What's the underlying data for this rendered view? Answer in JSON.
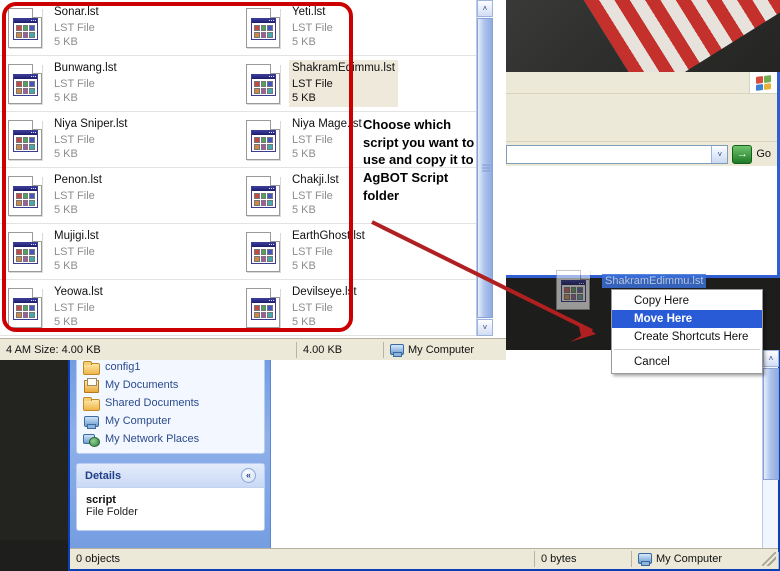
{
  "annotation": {
    "text": "Choose which script you want to use and copy it to AgBOT Script folder",
    "arrow_color": "#b02020",
    "highlight_box_color": "#cc0000"
  },
  "file_window": {
    "files": [
      {
        "name": "Sonar.lst",
        "type": "LST File",
        "size": "5 KB",
        "selected": false
      },
      {
        "name": "Yeti.lst",
        "type": "LST File",
        "size": "5 KB",
        "selected": false
      },
      {
        "name": "Bunwang.lst",
        "type": "LST File",
        "size": "5 KB",
        "selected": false
      },
      {
        "name": "ShakramEdimmu.lst",
        "type": "LST File",
        "size": "5 KB",
        "selected": true
      },
      {
        "name": "Niya Sniper.lst",
        "type": "LST File",
        "size": "5 KB",
        "selected": false
      },
      {
        "name": "Niya Mage.lst",
        "type": "LST File",
        "size": "5 KB",
        "selected": false
      },
      {
        "name": "Penon.lst",
        "type": "LST File",
        "size": "5 KB",
        "selected": false
      },
      {
        "name": "Chakji.lst",
        "type": "LST File",
        "size": "5 KB",
        "selected": false
      },
      {
        "name": "Mujigi.lst",
        "type": "LST File",
        "size": "5 KB",
        "selected": false
      },
      {
        "name": "EarthGhost.lst",
        "type": "LST File",
        "size": "5 KB",
        "selected": false
      },
      {
        "name": "Yeowa.lst",
        "type": "LST File",
        "size": "5 KB",
        "selected": false
      },
      {
        "name": "Devilseye.lst",
        "type": "LST File",
        "size": "5 KB",
        "selected": false
      }
    ],
    "status": {
      "info": "4 AM Size: 4.00 KB",
      "size": "4.00 KB",
      "zone": "My Computer"
    },
    "scrollbar": {
      "up_arrow": "˄",
      "down_arrow": "˅"
    }
  },
  "upper_right_window": {
    "title_buttons": {
      "minimize": "–",
      "maximize": "□",
      "close": "✕"
    },
    "address": {
      "value": "",
      "dropdown_arrow": "˅"
    },
    "go_button": {
      "arrow": "→",
      "label": "Go"
    }
  },
  "lower_window": {
    "sidebar_links": [
      {
        "label": "config1",
        "icon": "folder-icon"
      },
      {
        "label": "My Documents",
        "icon": "documents-icon"
      },
      {
        "label": "Shared Documents",
        "icon": "folder-icon"
      },
      {
        "label": "My Computer",
        "icon": "computer-icon"
      },
      {
        "label": "My Network Places",
        "icon": "network-icon"
      }
    ],
    "details_panel": {
      "header": "Details",
      "collapse_icon": "«",
      "name": "script",
      "type": "File Folder"
    },
    "status": {
      "objects": "0 objects",
      "size": "0 bytes",
      "zone": "My Computer"
    },
    "scrollbar": {
      "up_arrow": "˄",
      "down_arrow": "˅"
    }
  },
  "drag_operation": {
    "ghost_label": "ShakramEdimmu.lst",
    "context_menu": [
      {
        "label": "Copy Here",
        "active": false
      },
      {
        "label": "Move Here",
        "active": true
      },
      {
        "label": "Create Shortcuts Here",
        "active": false
      },
      {
        "separator": true
      },
      {
        "label": "Cancel",
        "active": false
      }
    ]
  }
}
